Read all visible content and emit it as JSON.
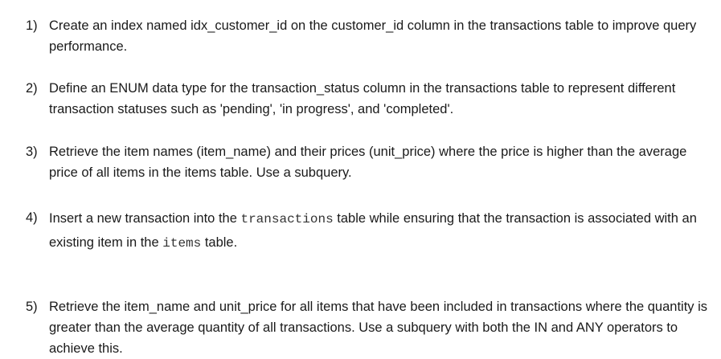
{
  "items": [
    {
      "number": "1)",
      "text": "Create an index named idx_customer_id on the customer_id column in the transactions table to improve query performance."
    },
    {
      "number": "2)",
      "text": "Define an ENUM data type for the transaction_status column in the transactions table to represent different transaction statuses such as 'pending', 'in progress', and 'completed'."
    },
    {
      "number": "3)",
      "text": "Retrieve the item names (item_name) and their prices (unit_price) where the price is higher than the average price of all items in the items table. Use a subquery."
    },
    {
      "number": "4)",
      "text_a": "Insert a new transaction into the ",
      "code_a": "transactions",
      "text_b": " table while ensuring that the transaction is associated with an existing item in the ",
      "code_b": "items",
      "text_c": " table."
    },
    {
      "number": "5)",
      "text": "Retrieve the item_name and unit_price for all items that have been included in transactions where the quantity is greater than the average quantity of all transactions. Use a subquery with both the IN and ANY operators to achieve this."
    }
  ]
}
